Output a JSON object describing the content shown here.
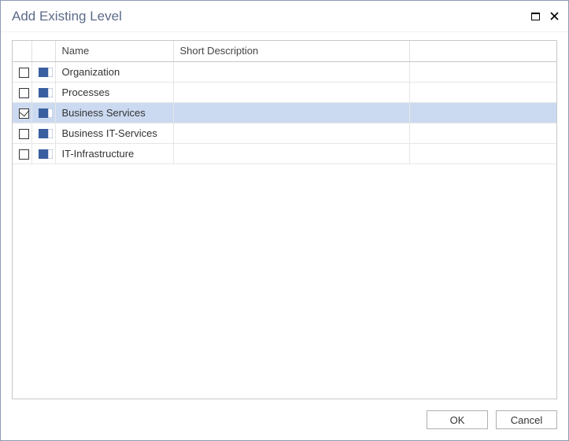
{
  "dialog": {
    "title": "Add Existing Level"
  },
  "grid": {
    "columns": {
      "name": "Name",
      "short_description": "Short Description"
    },
    "rows": [
      {
        "checked": false,
        "name": "Organization",
        "short_description": ""
      },
      {
        "checked": false,
        "name": "Processes",
        "short_description": ""
      },
      {
        "checked": true,
        "name": "Business Services",
        "short_description": ""
      },
      {
        "checked": false,
        "name": "Business IT-Services",
        "short_description": ""
      },
      {
        "checked": false,
        "name": "IT-Infrastructure",
        "short_description": ""
      }
    ],
    "selected_index": 2
  },
  "buttons": {
    "ok": "OK",
    "cancel": "Cancel"
  }
}
